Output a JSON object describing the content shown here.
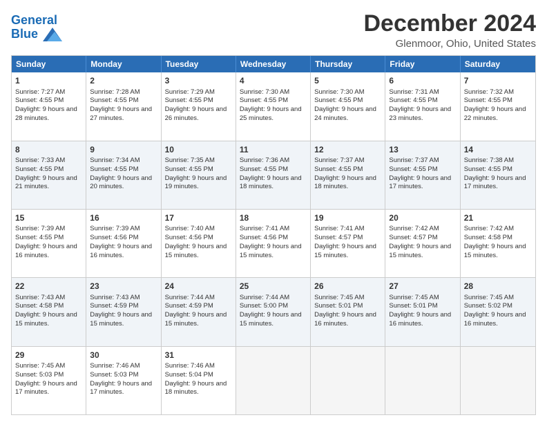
{
  "logo": {
    "line1": "General",
    "line2": "Blue"
  },
  "title": "December 2024",
  "subtitle": "Glenmoor, Ohio, United States",
  "days_of_week": [
    "Sunday",
    "Monday",
    "Tuesday",
    "Wednesday",
    "Thursday",
    "Friday",
    "Saturday"
  ],
  "weeks": [
    [
      {
        "day": "1",
        "sunrise": "7:27 AM",
        "sunset": "4:55 PM",
        "daylight": "9 hours and 28 minutes."
      },
      {
        "day": "2",
        "sunrise": "7:28 AM",
        "sunset": "4:55 PM",
        "daylight": "9 hours and 27 minutes."
      },
      {
        "day": "3",
        "sunrise": "7:29 AM",
        "sunset": "4:55 PM",
        "daylight": "9 hours and 26 minutes."
      },
      {
        "day": "4",
        "sunrise": "7:30 AM",
        "sunset": "4:55 PM",
        "daylight": "9 hours and 25 minutes."
      },
      {
        "day": "5",
        "sunrise": "7:30 AM",
        "sunset": "4:55 PM",
        "daylight": "9 hours and 24 minutes."
      },
      {
        "day": "6",
        "sunrise": "7:31 AM",
        "sunset": "4:55 PM",
        "daylight": "9 hours and 23 minutes."
      },
      {
        "day": "7",
        "sunrise": "7:32 AM",
        "sunset": "4:55 PM",
        "daylight": "9 hours and 22 minutes."
      }
    ],
    [
      {
        "day": "8",
        "sunrise": "7:33 AM",
        "sunset": "4:55 PM",
        "daylight": "9 hours and 21 minutes."
      },
      {
        "day": "9",
        "sunrise": "7:34 AM",
        "sunset": "4:55 PM",
        "daylight": "9 hours and 20 minutes."
      },
      {
        "day": "10",
        "sunrise": "7:35 AM",
        "sunset": "4:55 PM",
        "daylight": "9 hours and 19 minutes."
      },
      {
        "day": "11",
        "sunrise": "7:36 AM",
        "sunset": "4:55 PM",
        "daylight": "9 hours and 18 minutes."
      },
      {
        "day": "12",
        "sunrise": "7:37 AM",
        "sunset": "4:55 PM",
        "daylight": "9 hours and 18 minutes."
      },
      {
        "day": "13",
        "sunrise": "7:37 AM",
        "sunset": "4:55 PM",
        "daylight": "9 hours and 17 minutes."
      },
      {
        "day": "14",
        "sunrise": "7:38 AM",
        "sunset": "4:55 PM",
        "daylight": "9 hours and 17 minutes."
      }
    ],
    [
      {
        "day": "15",
        "sunrise": "7:39 AM",
        "sunset": "4:55 PM",
        "daylight": "9 hours and 16 minutes."
      },
      {
        "day": "16",
        "sunrise": "7:39 AM",
        "sunset": "4:56 PM",
        "daylight": "9 hours and 16 minutes."
      },
      {
        "day": "17",
        "sunrise": "7:40 AM",
        "sunset": "4:56 PM",
        "daylight": "9 hours and 15 minutes."
      },
      {
        "day": "18",
        "sunrise": "7:41 AM",
        "sunset": "4:56 PM",
        "daylight": "9 hours and 15 minutes."
      },
      {
        "day": "19",
        "sunrise": "7:41 AM",
        "sunset": "4:57 PM",
        "daylight": "9 hours and 15 minutes."
      },
      {
        "day": "20",
        "sunrise": "7:42 AM",
        "sunset": "4:57 PM",
        "daylight": "9 hours and 15 minutes."
      },
      {
        "day": "21",
        "sunrise": "7:42 AM",
        "sunset": "4:58 PM",
        "daylight": "9 hours and 15 minutes."
      }
    ],
    [
      {
        "day": "22",
        "sunrise": "7:43 AM",
        "sunset": "4:58 PM",
        "daylight": "9 hours and 15 minutes."
      },
      {
        "day": "23",
        "sunrise": "7:43 AM",
        "sunset": "4:59 PM",
        "daylight": "9 hours and 15 minutes."
      },
      {
        "day": "24",
        "sunrise": "7:44 AM",
        "sunset": "4:59 PM",
        "daylight": "9 hours and 15 minutes."
      },
      {
        "day": "25",
        "sunrise": "7:44 AM",
        "sunset": "5:00 PM",
        "daylight": "9 hours and 15 minutes."
      },
      {
        "day": "26",
        "sunrise": "7:45 AM",
        "sunset": "5:01 PM",
        "daylight": "9 hours and 16 minutes."
      },
      {
        "day": "27",
        "sunrise": "7:45 AM",
        "sunset": "5:01 PM",
        "daylight": "9 hours and 16 minutes."
      },
      {
        "day": "28",
        "sunrise": "7:45 AM",
        "sunset": "5:02 PM",
        "daylight": "9 hours and 16 minutes."
      }
    ],
    [
      {
        "day": "29",
        "sunrise": "7:45 AM",
        "sunset": "5:03 PM",
        "daylight": "9 hours and 17 minutes."
      },
      {
        "day": "30",
        "sunrise": "7:46 AM",
        "sunset": "5:03 PM",
        "daylight": "9 hours and 17 minutes."
      },
      {
        "day": "31",
        "sunrise": "7:46 AM",
        "sunset": "5:04 PM",
        "daylight": "9 hours and 18 minutes."
      },
      null,
      null,
      null,
      null
    ]
  ],
  "labels": {
    "sunrise": "Sunrise:",
    "sunset": "Sunset:",
    "daylight": "Daylight:"
  }
}
